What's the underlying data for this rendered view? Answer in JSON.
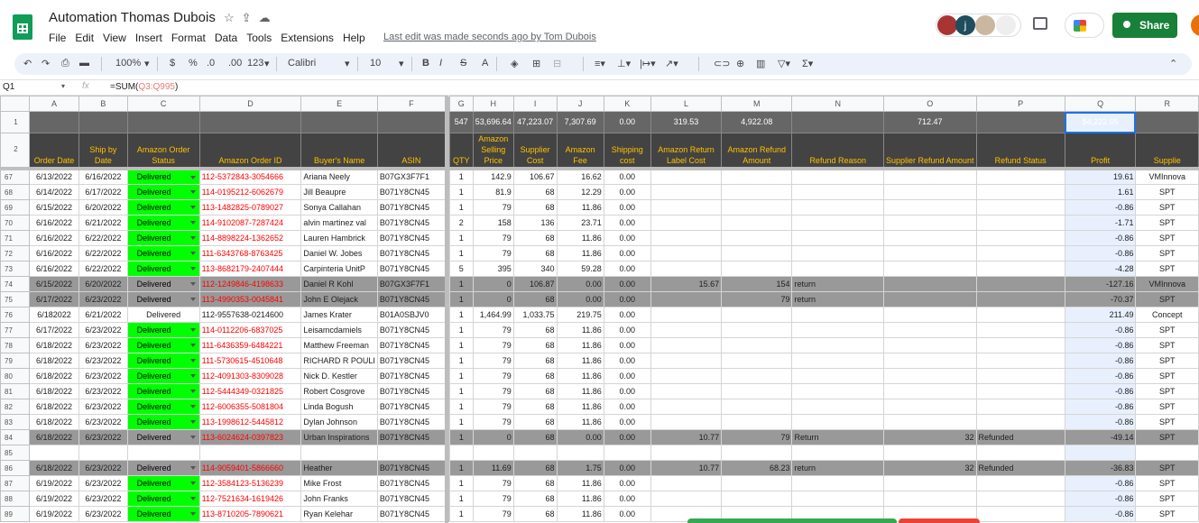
{
  "header": {
    "title": "Automation Thomas Dubois",
    "menus": [
      "File",
      "Edit",
      "View",
      "Insert",
      "Format",
      "Data",
      "Tools",
      "Extensions",
      "Help"
    ],
    "last_edit": "Last edit was made seconds ago by Tom Dubois",
    "share_label": "Share",
    "avatar_letter": "j"
  },
  "toolbar": {
    "zoom": "100%",
    "currency": "$",
    "percent": "%",
    "dec_less": ".0",
    "dec_more": ".00",
    "number_format": "123",
    "font": "Calibri",
    "font_size": "10"
  },
  "formula_bar": {
    "cell_ref": "Q1",
    "fx": "fx",
    "formula_prefix": "=SUM(",
    "formula_range": "Q3:Q995",
    "formula_suffix": ")"
  },
  "grid": {
    "columns": [
      "A",
      "B",
      "C",
      "D",
      "E",
      "F",
      "G",
      "H",
      "I",
      "J",
      "K",
      "L",
      "M",
      "N",
      "O",
      "P",
      "Q",
      "R"
    ],
    "totals": {
      "G": "547",
      "H": "53,696.64",
      "I": "47,223.07",
      "J": "7,307.69",
      "K": "0.00",
      "L": "319.53",
      "M": "4,922.08",
      "O": "712.47",
      "Q": "$4,222.65"
    },
    "headers": [
      "Order Date",
      "Ship by Date",
      "Amazon Order Status",
      "Amazon Order ID",
      "Buyer's Name",
      "ASIN",
      "QTY",
      "Amazon Selling Price",
      "Supplier Cost",
      "Amazon Fee",
      "Shipping cost",
      "Amazon Return Label Cost",
      "Amazon Refund Amount",
      "Refund Reason",
      "Supplier Refund Amount",
      "Refund Status",
      "Profit",
      "Supplie"
    ],
    "rows": [
      {
        "n": "67",
        "a": "6/13/2022",
        "b": "6/16/2022",
        "c": "Delivered",
        "d": "112-5372843-3054666",
        "e": "Ariana Neely",
        "f": "B07GX3F7F1",
        "g": "1",
        "h": "142.9",
        "i": "106.67",
        "j": "16.62",
        "k": "0.00",
        "l": "",
        "m": "",
        "n2": "",
        "o": "",
        "p": "",
        "q": "19.61",
        "r": "VMInnova"
      },
      {
        "n": "68",
        "a": "6/14/2022",
        "b": "6/17/2022",
        "c": "Delivered",
        "d": "114-0195212-6062679",
        "e": "Jill Beaupre",
        "f": "B071Y8CN45",
        "g": "1",
        "h": "81.9",
        "i": "68",
        "j": "12.29",
        "k": "0.00",
        "l": "",
        "m": "",
        "n2": "",
        "o": "",
        "p": "",
        "q": "1.61",
        "r": "SPT"
      },
      {
        "n": "69",
        "a": "6/15/2022",
        "b": "6/20/2022",
        "c": "Delivered",
        "d": "113-1482825-0789027",
        "e": "Sonya Callahan",
        "f": "B071Y8CN45",
        "g": "1",
        "h": "79",
        "i": "68",
        "j": "11.86",
        "k": "0.00",
        "l": "",
        "m": "",
        "n2": "",
        "o": "",
        "p": "",
        "q": "-0.86",
        "r": "SPT"
      },
      {
        "n": "70",
        "a": "6/16/2022",
        "b": "6/21/2022",
        "c": "Delivered",
        "d": "114-9102087-7287424",
        "e": "alvin martinez val",
        "f": "B071Y8CN45",
        "g": "2",
        "h": "158",
        "i": "136",
        "j": "23.71",
        "k": "0.00",
        "l": "",
        "m": "",
        "n2": "",
        "o": "",
        "p": "",
        "q": "-1.71",
        "r": "SPT"
      },
      {
        "n": "71",
        "a": "6/16/2022",
        "b": "6/22/2022",
        "c": "Delivered",
        "d": "114-8898224-1362652",
        "e": "Lauren Hambrick",
        "f": "B071Y8CN45",
        "g": "1",
        "h": "79",
        "i": "68",
        "j": "11.86",
        "k": "0.00",
        "l": "",
        "m": "",
        "n2": "",
        "o": "",
        "p": "",
        "q": "-0.86",
        "r": "SPT"
      },
      {
        "n": "72",
        "a": "6/16/2022",
        "b": "6/22/2022",
        "c": "Delivered",
        "d": "111-6343768-8763425",
        "e": "Daniel W. Jobes",
        "f": "B071Y8CN45",
        "g": "1",
        "h": "79",
        "i": "68",
        "j": "11.86",
        "k": "0.00",
        "l": "",
        "m": "",
        "n2": "",
        "o": "",
        "p": "",
        "q": "-0.86",
        "r": "SPT"
      },
      {
        "n": "73",
        "a": "6/16/2022",
        "b": "6/22/2022",
        "c": "Delivered",
        "d": "113-8682179-2407444",
        "e": "Carpinteria UnitP",
        "f": "B071Y8CN45",
        "g": "5",
        "h": "395",
        "i": "340",
        "j": "59.28",
        "k": "0.00",
        "l": "",
        "m": "",
        "n2": "",
        "o": "",
        "p": "",
        "q": "-4.28",
        "r": "SPT"
      },
      {
        "n": "74",
        "gray": true,
        "a": "6/15/2022",
        "b": "6/20/2022",
        "c": "Delivered",
        "d": "112-1249846-4198633",
        "e": "Daniel R Kohl",
        "f": "B07GX3F7F1",
        "g": "1",
        "h": "0",
        "i": "106.87",
        "j": "0.00",
        "k": "0.00",
        "l": "15.67",
        "m": "154",
        "n2": "return",
        "o": "",
        "p": "",
        "q": "-127.16",
        "r": "VMInnova"
      },
      {
        "n": "75",
        "gray": true,
        "a": "6/17/2022",
        "b": "6/23/2022",
        "c": "Delivered",
        "d": "113-4990353-0045841",
        "e": "John E Olejack",
        "f": "B071Y8CN45",
        "g": "1",
        "h": "0",
        "i": "68",
        "j": "0.00",
        "k": "0.00",
        "l": "",
        "m": "79",
        "n2": "return",
        "o": "",
        "p": "",
        "q": "-70.37",
        "r": "SPT"
      },
      {
        "n": "76",
        "plain": true,
        "a": "6/182022",
        "b": "6/21/2022",
        "c": "Delivered",
        "d": "112-9557638-0214600",
        "e": "James Krater",
        "f": "B01A0SBJV0",
        "g": "1",
        "h": "1,464.99",
        "i": "1,033.75",
        "j": "219.75",
        "k": "0.00",
        "l": "",
        "m": "",
        "n2": "",
        "o": "",
        "p": "",
        "q": "211.49",
        "r": "Concept"
      },
      {
        "n": "77",
        "a": "6/17/2022",
        "b": "6/23/2022",
        "c": "Delivered",
        "d": "114-0112206-6837025",
        "e": "Leisamcdamiels",
        "f": "B071Y8CN45",
        "g": "1",
        "h": "79",
        "i": "68",
        "j": "11.86",
        "k": "0.00",
        "l": "",
        "m": "",
        "n2": "",
        "o": "",
        "p": "",
        "q": "-0.86",
        "r": "SPT"
      },
      {
        "n": "78",
        "a": "6/18/2022",
        "b": "6/23/2022",
        "c": "Delivered",
        "d": "111-6436359-6484221",
        "e": "Matthew Freeman",
        "f": "B071Y8CN45",
        "g": "1",
        "h": "79",
        "i": "68",
        "j": "11.86",
        "k": "0.00",
        "l": "",
        "m": "",
        "n2": "",
        "o": "",
        "p": "",
        "q": "-0.86",
        "r": "SPT"
      },
      {
        "n": "79",
        "a": "6/18/2022",
        "b": "6/23/2022",
        "c": "Delivered",
        "d": "111-5730615-4510648",
        "e": "RICHARD R POULI",
        "f": "B071Y8CN45",
        "g": "1",
        "h": "79",
        "i": "68",
        "j": "11.86",
        "k": "0.00",
        "l": "",
        "m": "",
        "n2": "",
        "o": "",
        "p": "",
        "q": "-0.86",
        "r": "SPT"
      },
      {
        "n": "80",
        "a": "6/18/2022",
        "b": "6/23/2022",
        "c": "Delivered",
        "d": "112-4091303-8309028",
        "e": "Nick D. Kestler",
        "f": "B071Y8CN45",
        "g": "1",
        "h": "79",
        "i": "68",
        "j": "11.86",
        "k": "0.00",
        "l": "",
        "m": "",
        "n2": "",
        "o": "",
        "p": "",
        "q": "-0.86",
        "r": "SPT"
      },
      {
        "n": "81",
        "a": "6/18/2022",
        "b": "6/23/2022",
        "c": "Delivered",
        "d": "112-5444349-0321825",
        "e": "Robert Cosgrove",
        "f": "B071Y8CN45",
        "g": "1",
        "h": "79",
        "i": "68",
        "j": "11.86",
        "k": "0.00",
        "l": "",
        "m": "",
        "n2": "",
        "o": "",
        "p": "",
        "q": "-0.86",
        "r": "SPT"
      },
      {
        "n": "82",
        "a": "6/18/2022",
        "b": "6/23/2022",
        "c": "Delivered",
        "d": "112-6006355-5081804",
        "e": "Linda Bogush",
        "f": "B071Y8CN45",
        "g": "1",
        "h": "79",
        "i": "68",
        "j": "11.86",
        "k": "0.00",
        "l": "",
        "m": "",
        "n2": "",
        "o": "",
        "p": "",
        "q": "-0.86",
        "r": "SPT"
      },
      {
        "n": "83",
        "a": "6/18/2022",
        "b": "6/23/2022",
        "c": "Delivered",
        "d": "113-1998612-5445812",
        "e": "Dylan Johnson",
        "f": "B071Y8CN45",
        "g": "1",
        "h": "79",
        "i": "68",
        "j": "11.86",
        "k": "0.00",
        "l": "",
        "m": "",
        "n2": "",
        "o": "",
        "p": "",
        "q": "-0.86",
        "r": "SPT"
      },
      {
        "n": "84",
        "gray": true,
        "a": "6/18/2022",
        "b": "6/23/2022",
        "c": "Delivered",
        "d": "113-6024624-0397823",
        "e": "Urban Inspirations",
        "f": "B071Y8CN45",
        "g": "1",
        "h": "0",
        "i": "68",
        "j": "0.00",
        "k": "0.00",
        "l": "10.77",
        "m": "79",
        "n2": "Return",
        "o": "32",
        "p": "Refunded",
        "q": "-49.14",
        "r": "SPT"
      },
      {
        "n": "85",
        "empty": true
      },
      {
        "n": "86",
        "gray": true,
        "a": "6/18/2022",
        "b": "6/23/2022",
        "c": "Delivered",
        "d": "114-9059401-5866660",
        "e": "Heather",
        "f": "B071Y8CN45",
        "g": "1",
        "h": "11.69",
        "i": "68",
        "j": "1.75",
        "k": "0.00",
        "l": "10.77",
        "m": "68.23",
        "n2": "return",
        "o": "32",
        "p": "Refunded",
        "q": "-36.83",
        "r": "SPT"
      },
      {
        "n": "87",
        "a": "6/19/2022",
        "b": "6/23/2022",
        "c": "Delivered",
        "d": "112-3584123-5136239",
        "e": "Mike Frost",
        "f": "B071Y8CN45",
        "g": "1",
        "h": "79",
        "i": "68",
        "j": "11.86",
        "k": "0.00",
        "l": "",
        "m": "",
        "n2": "",
        "o": "",
        "p": "",
        "q": "-0.86",
        "r": "SPT"
      },
      {
        "n": "88",
        "a": "6/19/2022",
        "b": "6/23/2022",
        "c": "Delivered",
        "d": "112-7521634-1619426",
        "e": "John Franks",
        "f": "B071Y8CN45",
        "g": "1",
        "h": "79",
        "i": "68",
        "j": "11.86",
        "k": "0.00",
        "l": "",
        "m": "",
        "n2": "",
        "o": "",
        "p": "",
        "q": "-0.86",
        "r": "SPT"
      },
      {
        "n": "89",
        "a": "6/19/2022",
        "b": "6/23/2022",
        "c": "Delivered",
        "d": "113-8710205-7890621",
        "e": "Ryan Kelehar",
        "f": "B071Y8CN45",
        "g": "1",
        "h": "79",
        "i": "68",
        "j": "11.86",
        "k": "0.00",
        "l": "",
        "m": "",
        "n2": "",
        "o": "",
        "p": "",
        "q": "-0.86",
        "r": "SPT"
      }
    ]
  }
}
